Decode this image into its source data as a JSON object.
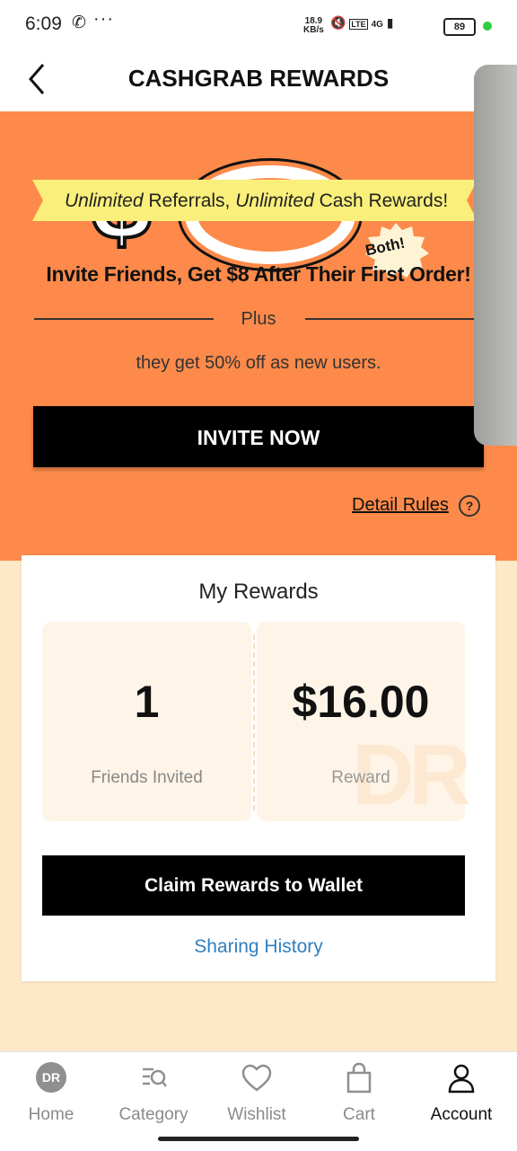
{
  "status_bar": {
    "time": "6:09",
    "speed_value": "18.9",
    "speed_unit": "KB/s",
    "network": "4G",
    "battery": "89"
  },
  "header": {
    "title": "CASHGRAB REWARDS"
  },
  "hero": {
    "badge": "Both!",
    "ribbon_italic_1": "Unlimited",
    "ribbon_text_1": " Referrals, ",
    "ribbon_italic_2": "Unlimited",
    "ribbon_text_2": " Cash Rewards!",
    "heading": "Invite Friends, Get $8 After Their First Order!",
    "plus": "Plus",
    "subtext": "they get 50% off as new users.",
    "invite_button": "INVITE NOW",
    "detail_rules": "Detail Rules"
  },
  "rewards": {
    "title": "My Rewards",
    "friends_invited_value": "1",
    "friends_invited_label": "Friends Invited",
    "reward_value": "$16.00",
    "reward_label": "Reward",
    "watermark": "DR",
    "claim_button": "Claim Rewards to Wallet",
    "sharing_history": "Sharing History"
  },
  "nav": {
    "items": [
      {
        "label": "Home",
        "icon": "dr-logo-icon"
      },
      {
        "label": "Category",
        "icon": "category-search-icon"
      },
      {
        "label": "Wishlist",
        "icon": "heart-icon"
      },
      {
        "label": "Cart",
        "icon": "shopping-bag-icon"
      },
      {
        "label": "Account",
        "icon": "person-icon"
      }
    ],
    "active": "Account",
    "home_logo_text": "DR"
  },
  "colors": {
    "orange": "#fd8a4a",
    "cream": "#fde9c8",
    "ribbon_yellow": "#f9ef7a",
    "link_blue": "#2f7fc0"
  }
}
